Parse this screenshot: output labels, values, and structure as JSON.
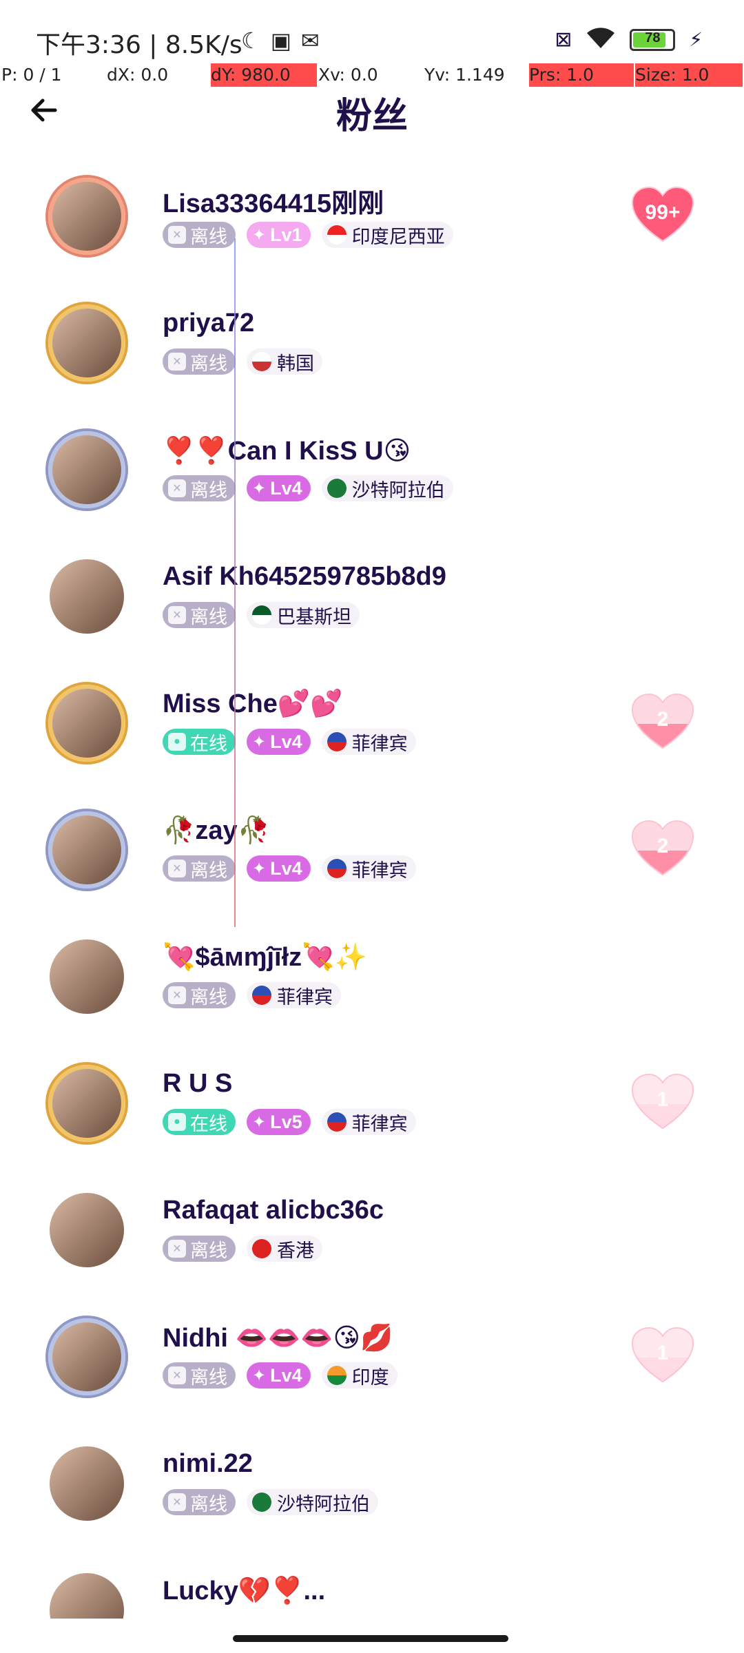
{
  "status": {
    "time": "下午3:36 | 8.5K/s",
    "icons": [
      "moon-icon",
      "sim-icon",
      "mail-icon"
    ],
    "battery": "78"
  },
  "debug": {
    "p": "P: 0 / 1",
    "dx": "dX: 0.0",
    "dy": "dY: 980.0",
    "xv": "Xv: 0.0",
    "yv": "Yv: 1.149",
    "prs": "Prs: 1.0",
    "size": "Size: 1.0"
  },
  "header": {
    "title": "粉丝"
  },
  "colors": {
    "offline": "#b7afc8",
    "online": "#40d8b4",
    "level": "#d86be4",
    "heart": "#ff5a7a"
  },
  "fans": [
    {
      "name": "Lisa33364415刚刚",
      "status": "离线",
      "online": false,
      "level": "Lv1",
      "country": "印度尼西亚",
      "flag": [
        "#e22",
        "#fff"
      ],
      "frame": "rose",
      "heart": "99+",
      "heart_style": "full"
    },
    {
      "name": "priya72",
      "status": "离线",
      "online": false,
      "level": "",
      "country": "韩国",
      "flag": [
        "#fff",
        "#c33"
      ],
      "frame": "gold",
      "heart": "",
      "heart_style": ""
    },
    {
      "name": "❣️❣️Can I KisS U😘",
      "status": "离线",
      "online": false,
      "level": "Lv4",
      "country": "沙特阿拉伯",
      "flag": [
        "#1a7a3a",
        "#1a7a3a"
      ],
      "frame": "silver",
      "heart": "",
      "heart_style": ""
    },
    {
      "name": "Asif Kh645259785b8d9",
      "status": "离线",
      "online": false,
      "level": "",
      "country": "巴基斯坦",
      "flag": [
        "#0b5a2a",
        "#fff"
      ],
      "frame": "plain",
      "heart": "",
      "heart_style": ""
    },
    {
      "name": "Miss Che💕💕",
      "status": "在线",
      "online": true,
      "level": "Lv4",
      "country": "菲律宾",
      "flag": [
        "#2b4fb5",
        "#d22"
      ],
      "frame": "gold",
      "heart": "2",
      "heart_style": "half"
    },
    {
      "name": "🥀zay🥀",
      "status": "离线",
      "online": false,
      "level": "Lv4",
      "country": "菲律宾",
      "flag": [
        "#2b4fb5",
        "#d22"
      ],
      "frame": "silver",
      "heart": "2",
      "heart_style": "half"
    },
    {
      "name": "💘$āмɱĵīłz💘✨",
      "status": "离线",
      "online": false,
      "level": "",
      "country": "菲律宾",
      "flag": [
        "#2b4fb5",
        "#d22"
      ],
      "frame": "plain",
      "heart": "",
      "heart_style": ""
    },
    {
      "name": "R U S",
      "status": "在线",
      "online": true,
      "level": "Lv5",
      "country": "菲律宾",
      "flag": [
        "#2b4fb5",
        "#d22"
      ],
      "frame": "gold",
      "heart": "1",
      "heart_style": "faint"
    },
    {
      "name": "Rafaqat alicbc36c",
      "status": "离线",
      "online": false,
      "level": "",
      "country": "香港",
      "flag": [
        "#d22",
        "#d22"
      ],
      "frame": "plain",
      "heart": "",
      "heart_style": ""
    },
    {
      "name": "Nidhi 👄👄👄😘💋",
      "status": "离线",
      "online": false,
      "level": "Lv4",
      "country": "印度",
      "flag": [
        "#f39a2b",
        "#138a3a"
      ],
      "frame": "silver",
      "heart": "1",
      "heart_style": "faint"
    },
    {
      "name": "nimi.22",
      "status": "离线",
      "online": false,
      "level": "",
      "country": "沙特阿拉伯",
      "flag": [
        "#1a7a3a",
        "#1a7a3a"
      ],
      "frame": "plain",
      "heart": "",
      "heart_style": ""
    },
    {
      "name": "Lucky💔❣️...",
      "status": "",
      "online": false,
      "level": "",
      "country": "",
      "flag": [
        "#1a7a3a",
        "#1a7a3a"
      ],
      "frame": "plain",
      "heart": "",
      "heart_style": ""
    }
  ]
}
